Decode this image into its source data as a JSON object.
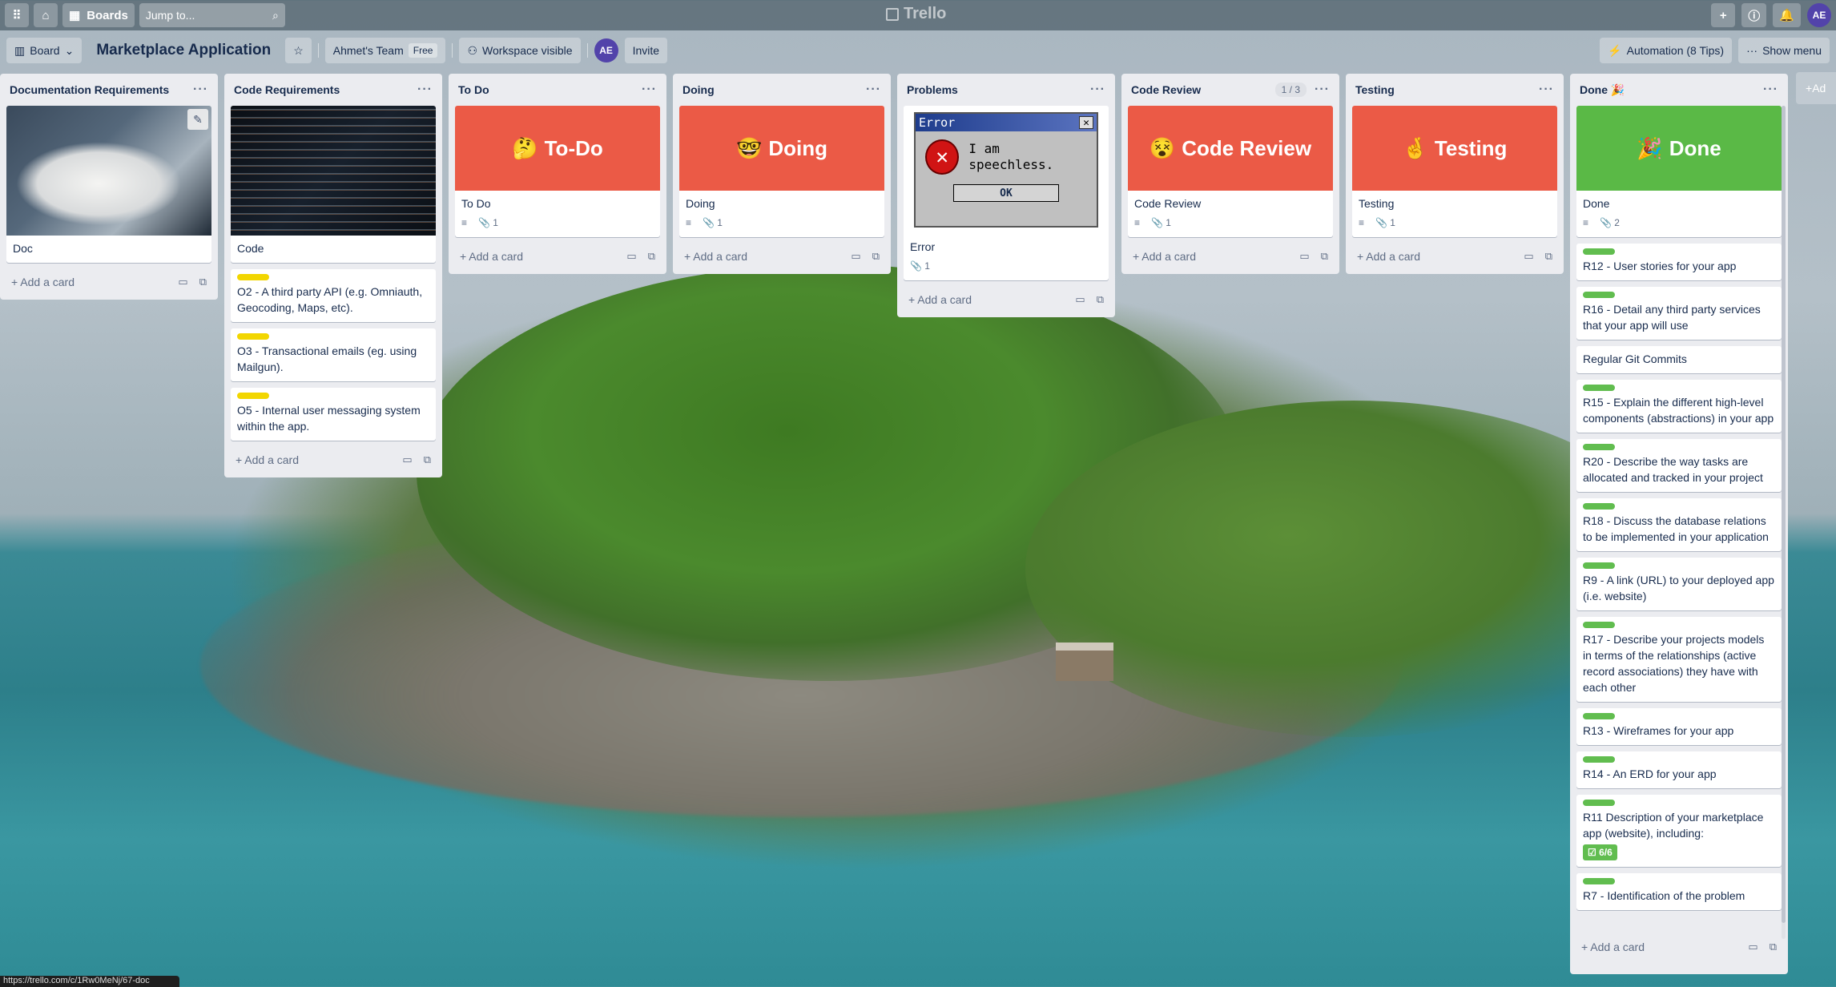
{
  "topbar": {
    "boards_label": "Boards",
    "jump_placeholder": "Jump to...",
    "logo": "Trello",
    "avatar_initials": "AE"
  },
  "header": {
    "view_label": "Board",
    "title": "Marketplace Application",
    "team_label": "Ahmet's Team",
    "team_plan": "Free",
    "visibility_label": "Workspace visible",
    "member_initials": "AE",
    "invite_label": "Invite",
    "automation_label": "Automation (8 Tips)",
    "menu_label": "Show menu"
  },
  "add_card_label": "Add a card",
  "add_list_label": "Ad",
  "status_url": "https://trello.com/c/1Rw0MeNj/67-doc",
  "lists": [
    {
      "title": "Documentation Requirements",
      "cards": [
        {
          "title": "Doc",
          "cover": "photo-doc"
        }
      ]
    },
    {
      "title": "Code Requirements",
      "cards": [
        {
          "title": "Code",
          "cover": "photo-code"
        },
        {
          "title": "O2 - A third party API (e.g. Omniauth, Geocoding, Maps, etc).",
          "label": "yellow"
        },
        {
          "title": "O3 - Transactional emails (eg. using Mailgun).",
          "label": "yellow"
        },
        {
          "title": "O5 - Internal user messaging system within the app.",
          "label": "yellow"
        }
      ]
    },
    {
      "title": "To Do",
      "cards": [
        {
          "cover_text": "To-Do",
          "cover_emoji": "🤔",
          "title": "To Do",
          "attachments": "1"
        }
      ]
    },
    {
      "title": "Doing",
      "cards": [
        {
          "cover_text": "Doing",
          "cover_emoji": "🤓",
          "title": "Doing",
          "attachments": "1"
        }
      ]
    },
    {
      "title": "Problems",
      "cards": [
        {
          "title": "Error",
          "attachments": "1",
          "dialog_title": "Error",
          "dialog_text": "I am speechless.",
          "dialog_button": "OK"
        }
      ]
    },
    {
      "title": "Code Review",
      "count": "1 / 3",
      "cards": [
        {
          "cover_text": "Code Review",
          "cover_emoji": "😵",
          "title": "Code Review",
          "attachments": "1"
        }
      ]
    },
    {
      "title": "Testing",
      "cards": [
        {
          "cover_text": "Testing",
          "cover_emoji": "🤞",
          "title": "Testing",
          "attachments": "1"
        }
      ]
    },
    {
      "title": "Done",
      "title_emoji": "🎉",
      "cards": [
        {
          "cover_text": "Done",
          "cover_emoji": "🎉",
          "title": "Done",
          "attachments": "2"
        },
        {
          "title": "R12 - User stories for your app",
          "label": "green"
        },
        {
          "title": "R16 - Detail any third party services that your app will use",
          "label": "green"
        },
        {
          "title": "Regular Git Commits"
        },
        {
          "title": "R15 - Explain the different high-level components (abstractions) in your app",
          "label": "green"
        },
        {
          "title": "R20 - Describe the way tasks are allocated and tracked in your project",
          "label": "green"
        },
        {
          "title": "R18 - Discuss the database relations to be implemented in your application",
          "label": "green"
        },
        {
          "title": "R9 - A link (URL) to your deployed app (i.e. website)",
          "label": "green"
        },
        {
          "title": "R17 - Describe your projects models in terms of the relationships (active record associations) they have with each other",
          "label": "green"
        },
        {
          "title": "R13 - Wireframes for your app",
          "label": "green"
        },
        {
          "title": "R14 - An ERD for your app",
          "label": "green"
        },
        {
          "title": "R11 Description of your marketplace app (website), including:",
          "label": "green",
          "checklist": "6/6"
        },
        {
          "title": "R7 - Identification of the problem",
          "label": "green"
        }
      ]
    }
  ]
}
